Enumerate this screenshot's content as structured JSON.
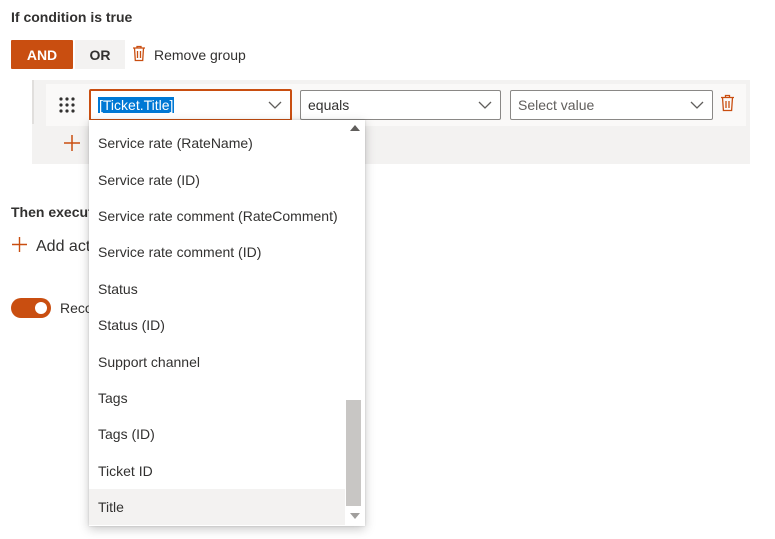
{
  "condition": {
    "title": "If condition is true",
    "and_label": "AND",
    "or_label": "OR",
    "remove_group_label": "Remove group"
  },
  "rule": {
    "field_value": "[Ticket.Title]",
    "operator_value": "equals",
    "value_placeholder": "Select value"
  },
  "actions": {
    "title": "Then execute",
    "add_action_label": "Add act"
  },
  "toggle": {
    "label": "Reco",
    "on": true
  },
  "dropdown": {
    "items": [
      {
        "label": "Service rate (RateName)"
      },
      {
        "label": "Service rate (ID)"
      },
      {
        "label": "Service rate comment (RateComment)"
      },
      {
        "label": "Service rate comment (ID)"
      },
      {
        "label": "Status"
      },
      {
        "label": "Status (ID)"
      },
      {
        "label": "Support channel"
      },
      {
        "label": "Tags"
      },
      {
        "label": "Tags (ID)"
      },
      {
        "label": "Ticket ID"
      },
      {
        "label": "Title"
      }
    ],
    "highlighted_index": 10
  },
  "colors": {
    "accent": "#c94e10",
    "selection": "#0078d4",
    "panel": "#f3f2f1"
  },
  "icons": {
    "trash": "trash-icon",
    "chevron": "chevron-down-icon",
    "grip": "drag-handle-icon",
    "plus": "plus-icon"
  }
}
